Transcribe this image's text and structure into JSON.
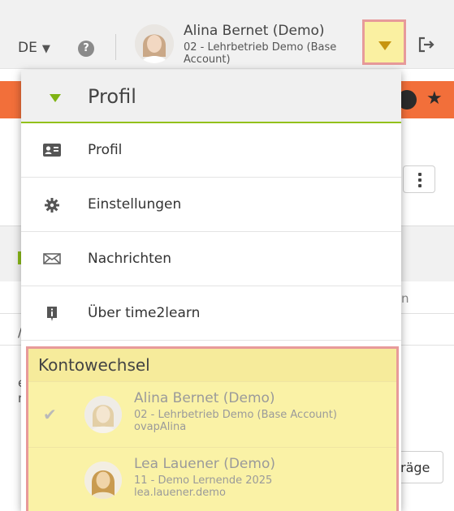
{
  "header": {
    "language": "DE",
    "help_icon": "question-circle-icon",
    "help_glyph": "?",
    "user": {
      "name": "Alina Bernet (Demo)",
      "subtitle": "02 - Lehrbetrieb Demo (Base Account)"
    },
    "dropdown_icon": "caret-down-icon",
    "logout_icon": "sign-out-icon"
  },
  "background": {
    "partial_text_n": "n",
    "partial_text_1": "/",
    "partial_text_2": "e\nn",
    "partial_button": "räge"
  },
  "menu": {
    "title": "Profil",
    "items": [
      {
        "label": "Profil",
        "icon": "id-card-icon"
      },
      {
        "label": "Einstellungen",
        "icon": "gear-icon"
      },
      {
        "label": "Nachrichten",
        "icon": "envelope-icon"
      },
      {
        "label": "Über time2learn",
        "icon": "info-icon"
      }
    ],
    "account_switch": {
      "title": "Kontowechsel",
      "accounts": [
        {
          "name": "Alina Bernet (Demo)",
          "line2": "02 - Lehrbetrieb Demo (Base Account)",
          "line3": "ovapAlina",
          "active": true
        },
        {
          "name": "Lea Lauener (Demo)",
          "line2": "11 - Demo Lernende 2025",
          "line3": "lea.lauener.demo",
          "active": false
        }
      ]
    }
  },
  "colors": {
    "accent_green": "#8cbc1a",
    "highlight_yellow": "#faf2a6",
    "highlight_border": "#e79a9a",
    "header_orange": "#f26f3a"
  }
}
